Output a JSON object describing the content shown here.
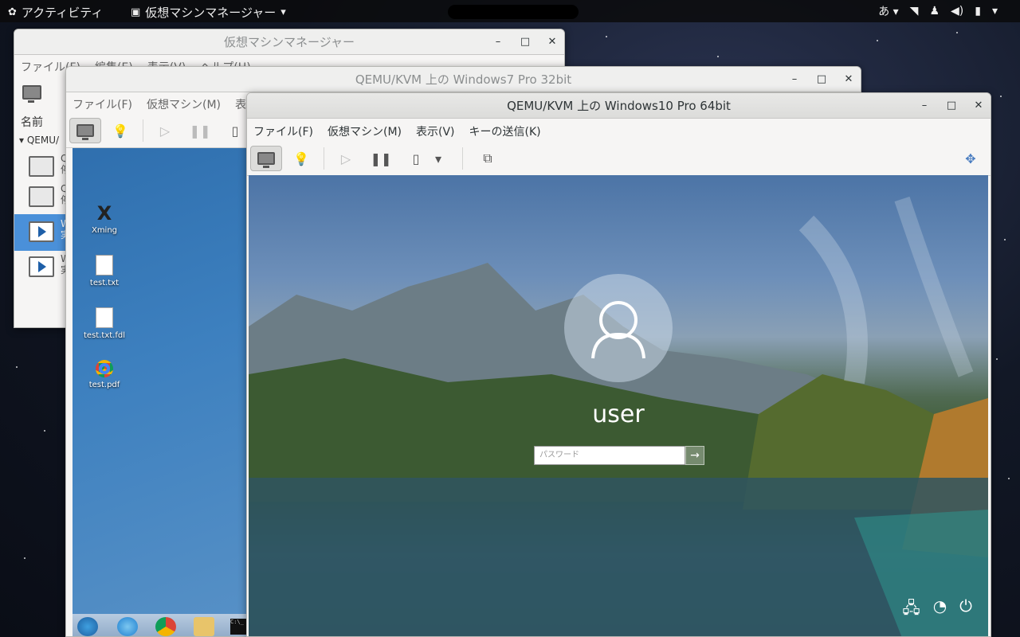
{
  "topbar": {
    "activities": "アクティビティ",
    "app_menu": "仮想マシンマネージャー",
    "ime": "あ",
    "colors": {
      "bar": "#0a0a0c"
    }
  },
  "manager": {
    "title": "仮想マシンマネージャー",
    "menu": [
      "ファイル(F)",
      "編集(E)",
      "表示(V)",
      "ヘルプ(H)"
    ],
    "column_name": "名前",
    "group": "QEMU/",
    "vms": [
      {
        "line1": "Q",
        "line2": "停"
      },
      {
        "line1": "Q",
        "line2": "停"
      },
      {
        "line1": "W",
        "line2": "実"
      },
      {
        "line1": "W",
        "line2": "実"
      }
    ]
  },
  "win7": {
    "title": "QEMU/KVM 上の Windows7 Pro 32bit",
    "menu": [
      "ファイル(F)",
      "仮想マシン(M)",
      "表示"
    ],
    "desktop_icons": [
      "Xming",
      "test.txt",
      "test.txt.fdl",
      "test.pdf"
    ],
    "cmd_label": "C:\\_"
  },
  "win10": {
    "title": "QEMU/KVM 上の Windows10 Pro 64bit",
    "menu": [
      "ファイル(F)",
      "仮想マシン(M)",
      "表示(V)",
      "キーの送信(K)"
    ],
    "username": "user",
    "password_placeholder": "パスワード",
    "submit_arrow": "→"
  },
  "window_buttons": {
    "minimize": "–",
    "maximize": "□",
    "close": "✕"
  }
}
